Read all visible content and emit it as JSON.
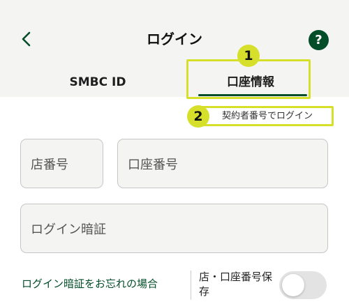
{
  "header": {
    "title": "ログイン",
    "help_label": "?",
    "back_icon": "chevron-left-icon"
  },
  "tabs": [
    {
      "label": "SMBC ID",
      "active": false
    },
    {
      "label": "口座情報",
      "active": true
    }
  ],
  "annotations": {
    "badge_1": "1",
    "badge_2": "2",
    "accent_color": "#d6e02a"
  },
  "contract_link_label": "契約者番号でログイン",
  "form": {
    "branch_placeholder": "店番号",
    "account_placeholder": "口座番号",
    "password_placeholder": "ログイン暗証"
  },
  "footer": {
    "forgot_label": "ログイン暗証をお忘れの場合",
    "save_label": "店・口座番号保存",
    "save_toggle_on": false
  },
  "colors": {
    "brand_green": "#044d29",
    "header_bg": "#f4f4f2"
  }
}
